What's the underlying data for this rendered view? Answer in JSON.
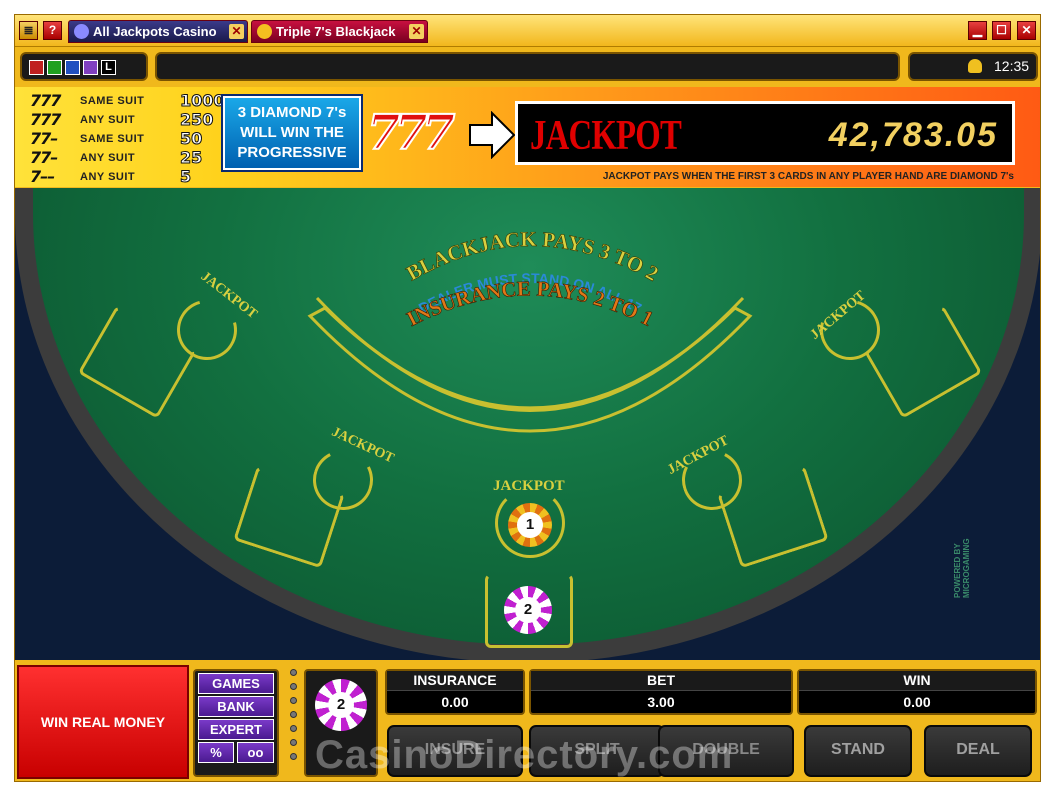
{
  "titlebar": {
    "tabs": [
      {
        "label": "All Jackpots Casino"
      },
      {
        "label": "Triple 7's Blackjack"
      }
    ],
    "menu_btn": "≣",
    "help_btn": "?",
    "close_glyph": "✕",
    "minimize_glyph": "▁",
    "maximize_glyph": "☐",
    "window_close_glyph": "✕"
  },
  "toolbar": {
    "clock": "12:35",
    "options_box": "L"
  },
  "paytable": [
    {
      "symbols": "777",
      "name": "SAME SUIT",
      "payout": "1000"
    },
    {
      "symbols": "777",
      "name": "ANY SUIT",
      "payout": "250"
    },
    {
      "symbols": "77–",
      "name": "SAME SUIT",
      "payout": "50"
    },
    {
      "symbols": "77–",
      "name": "ANY SUIT",
      "payout": "25"
    },
    {
      "symbols": "7––",
      "name": "ANY SUIT",
      "payout": "5"
    }
  ],
  "promo": {
    "line1": "3 DIAMOND 7's",
    "line2": "WILL WIN THE",
    "line3": "PROGRESSIVE"
  },
  "sevens": "777",
  "jackpot": {
    "label": "JACKPOT",
    "amount": "42,783.05",
    "note": "JACKPOT PAYS WHEN THE FIRST 3 CARDS IN ANY PLAYER HAND ARE DIAMOND 7's"
  },
  "felt": {
    "blackjack_pays": "BLACKJACK PAYS 3 TO 2",
    "dealer_stand": "DEALER MUST STAND ON ALL 17",
    "insurance_pays": "INSURANCE PAYS 2 TO 1",
    "jackpot_word": "JACKPOT",
    "powered_by": "POWERED BY MICROGAMING"
  },
  "chips": {
    "jackpot_chip": "1",
    "bet_chip": "2",
    "selected_chip": "2"
  },
  "controls": {
    "win_real_money": "WIN REAL MONEY",
    "games": "GAMES",
    "bank": "BANK",
    "expert": "EXPERT",
    "percent": "%",
    "link_icon": "oo",
    "insurance_label": "INSURANCE",
    "insurance_value": "0.00",
    "bet_label": "BET",
    "bet_value": "3.00",
    "win_label": "WIN",
    "win_value": "0.00",
    "insure": "INSURE",
    "split": "SPLIT",
    "double": "DOUBLE",
    "stand": "STAND",
    "deal": "DEAL",
    "watermark": "CasinoDirectory.com"
  },
  "colors": {
    "frame": "#f0b81c",
    "felt": "#127040",
    "felt_line": "#c8c030",
    "jackpot_red": "#e00000",
    "jackpot_gold": "#f2d060",
    "win_real_money": "#e01010"
  }
}
